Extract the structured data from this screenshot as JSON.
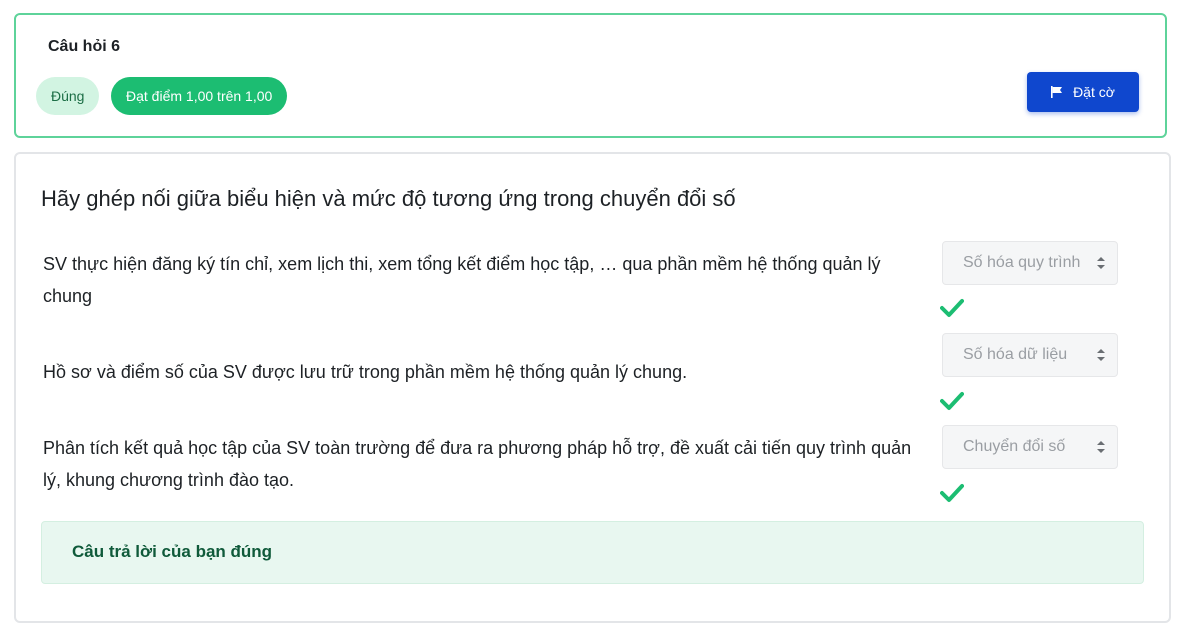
{
  "question": {
    "title": "Câu hỏi 6",
    "status_badge": "Đúng",
    "grade_badge": "Đạt điểm 1,00 trên 1,00",
    "flag_button": "Đặt cờ"
  },
  "content": {
    "prompt": "Hãy ghép nối giữa biểu hiện và mức độ tương ứng trong chuyển đổi số",
    "rows": [
      {
        "text": "SV thực hiện đăng ký tín chỉ, xem lịch thi, xem tổng kết điểm học tập, … qua phần mềm hệ thống quản lý chung",
        "selected": "Số hóa quy trình"
      },
      {
        "text": "Hồ sơ và điểm số của SV được lưu trữ trong phần mềm hệ thống quản lý chung.",
        "selected": "Số hóa dữ liệu"
      },
      {
        "text": "Phân tích kết quả học tập của SV toàn trường để đưa ra phương pháp hỗ trợ, đề xuất cải tiến quy trình quản lý, khung chương trình đào tạo.",
        "selected": "Chuyển đổi số"
      }
    ],
    "feedback": "Câu trả lời của bạn đúng"
  },
  "colors": {
    "correct_border": "#5ed39a",
    "grade_badge_bg": "#1cbd72",
    "flag_button_bg": "#0f47ce",
    "check_color": "#1cbd72"
  },
  "icons": {
    "flag": "flag-icon",
    "check": "check-icon",
    "select_caret": "sort-caret-icon"
  }
}
